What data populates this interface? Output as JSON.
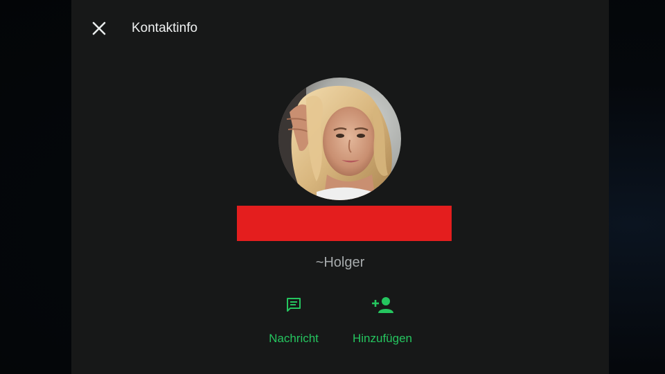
{
  "header": {
    "close_icon": "close-icon",
    "title": "Kontaktinfo"
  },
  "profile": {
    "avatar_alt": "profile photo",
    "name_redacted": true,
    "redaction_color": "#e41e1e",
    "subname": "~Holger"
  },
  "actions": [
    {
      "label": "Nachricht",
      "icon": "message-icon"
    },
    {
      "label": "Hinzufügen",
      "icon": "add-contact-icon"
    }
  ],
  "colors": {
    "panel_bg": "#171818",
    "accent": "#25c55f",
    "title_text": "#f0f2f2",
    "subtext": "#a7abad"
  }
}
